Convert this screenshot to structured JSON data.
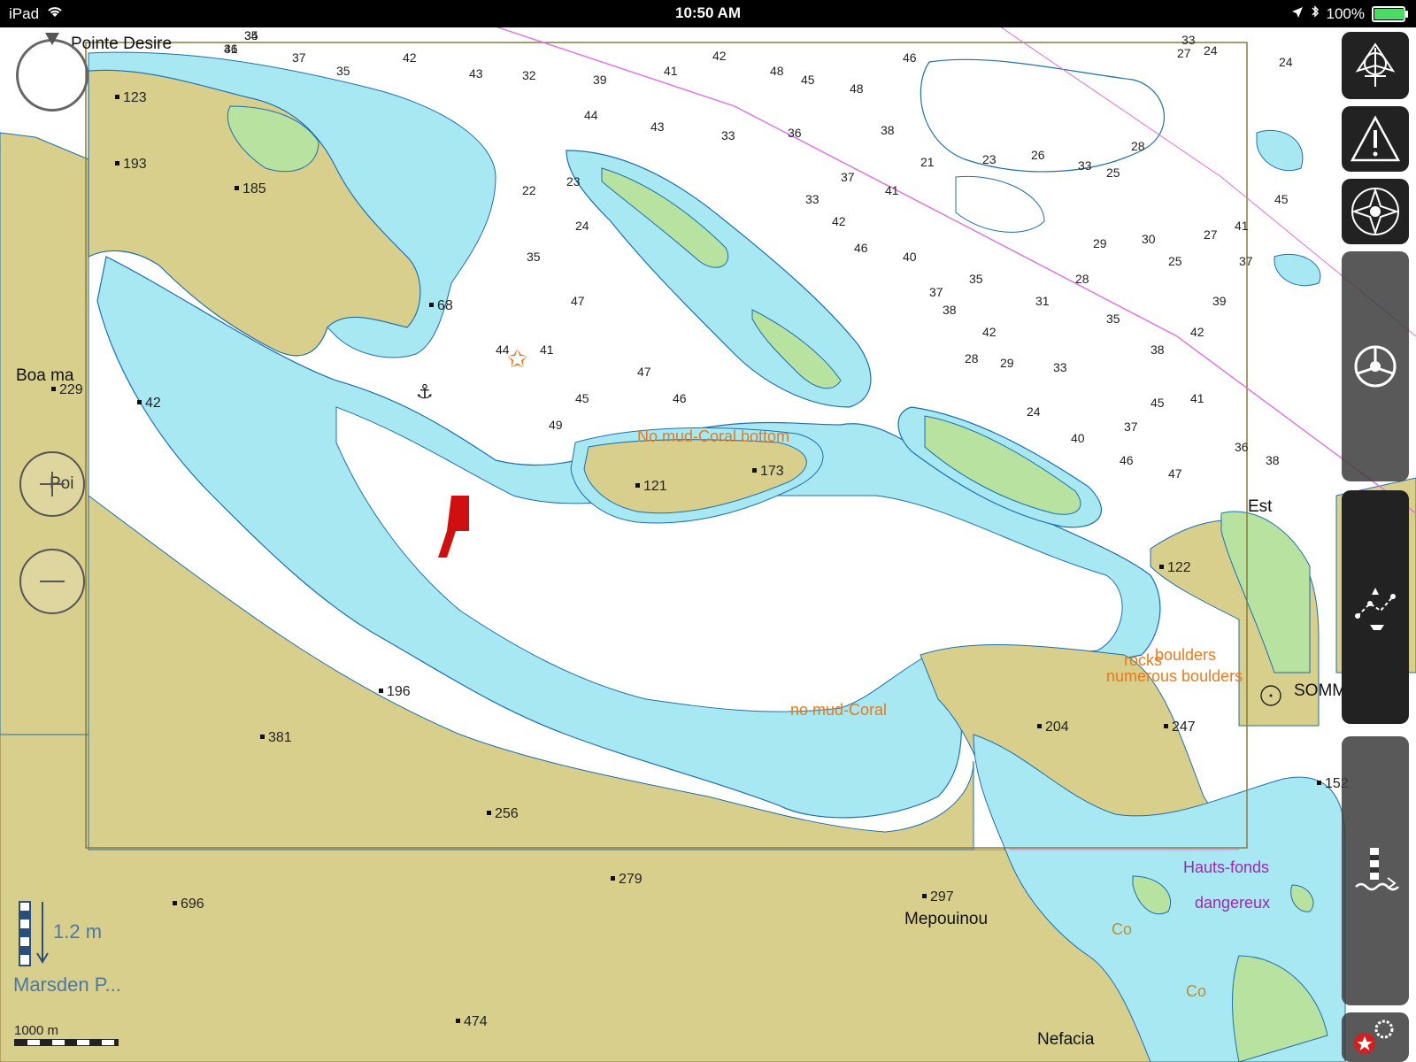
{
  "status_bar": {
    "device": "iPad",
    "time": "10:50 AM",
    "battery": "100%",
    "battery_level": 1.0
  },
  "colors": {
    "land": "#d9cf8d",
    "deep_water": "#ffffff",
    "shallow_water": "#a8e8f3",
    "very_shallow": "#5fd2ea",
    "drying": "#b8e2a0",
    "contour": "#1d6fb0",
    "route_line": "#e070e0",
    "note_orange": "#e87a1a",
    "note_purple": "#a028b0",
    "toolbar_bg": "#222222"
  },
  "place_names": [
    {
      "id": "pointe-desire",
      "text": "Pointe Desire"
    },
    {
      "id": "boa-ma",
      "text": "Boa ma"
    },
    {
      "id": "poi",
      "text": "Poi"
    },
    {
      "id": "est",
      "text": "Est"
    },
    {
      "id": "sommet",
      "text": "SOMMET"
    },
    {
      "id": "mepouinou",
      "text": "Mepouinou"
    },
    {
      "id": "nefacia",
      "text": "Nefacia"
    }
  ],
  "chart_notes": [
    {
      "id": "note-coral-bottom",
      "text": "No mud-Coral bottom",
      "color": "orange"
    },
    {
      "id": "note-boulders",
      "text": "boulders",
      "color": "orange"
    },
    {
      "id": "note-rocks",
      "text": "rocks",
      "color": "orange"
    },
    {
      "id": "note-numerous-boulders",
      "text": "numerous boulders",
      "color": "orange"
    },
    {
      "id": "note-no-mud-coral",
      "text": "no mud-Coral",
      "color": "orange"
    },
    {
      "id": "note-hauts-fonds",
      "text": "Hauts-fonds",
      "color": "purple"
    },
    {
      "id": "note-dangereux",
      "text": "dangereux",
      "color": "purple"
    },
    {
      "id": "note-co-1",
      "text": "Co",
      "color": "orange"
    },
    {
      "id": "note-co-2",
      "text": "Co",
      "color": "orange"
    }
  ],
  "land_heights": [
    "123",
    "193",
    "185",
    "68",
    "229",
    "42",
    "196",
    "381",
    "256",
    "279",
    "696",
    "474",
    "297",
    "173",
    "121",
    "204",
    "247",
    "122",
    "152"
  ],
  "soundings": [
    "34",
    "36",
    "37",
    "35",
    "42",
    "43",
    "32",
    "39",
    "41",
    "42",
    "48",
    "45",
    "48",
    "46",
    "44",
    "43",
    "33",
    "36",
    "38",
    "21",
    "23",
    "26",
    "33",
    "28",
    "25",
    "27",
    "24",
    "22",
    "23",
    "24",
    "35",
    "47",
    "44",
    "41",
    "45",
    "47",
    "46",
    "49",
    "33",
    "37",
    "41",
    "42",
    "46",
    "40",
    "37",
    "35",
    "38",
    "42",
    "31",
    "28",
    "29",
    "30",
    "25",
    "27",
    "41",
    "39",
    "38",
    "35",
    "33",
    "29",
    "28",
    "24",
    "40",
    "37",
    "45",
    "41",
    "36",
    "38",
    "47",
    "46",
    "42",
    "37",
    "45",
    "33",
    "24",
    "35",
    "41"
  ],
  "map_labels": {
    "tide_value": "1.2 m",
    "tide_station": "Marsden P...",
    "scale": "1000 m"
  },
  "toolbar": {
    "items": [
      {
        "id": "route-tool",
        "icon": "route-icon"
      },
      {
        "id": "warning-tool",
        "icon": "warning-icon"
      },
      {
        "id": "compass-tool",
        "icon": "compass-rose-icon"
      },
      {
        "id": "helm-tool",
        "icon": "helm-icon"
      },
      {
        "id": "track-tool",
        "icon": "track-boat-icon"
      },
      {
        "id": "tide-tool",
        "icon": "tide-icon"
      },
      {
        "id": "settings-tool",
        "icon": "settings-icon"
      }
    ]
  }
}
